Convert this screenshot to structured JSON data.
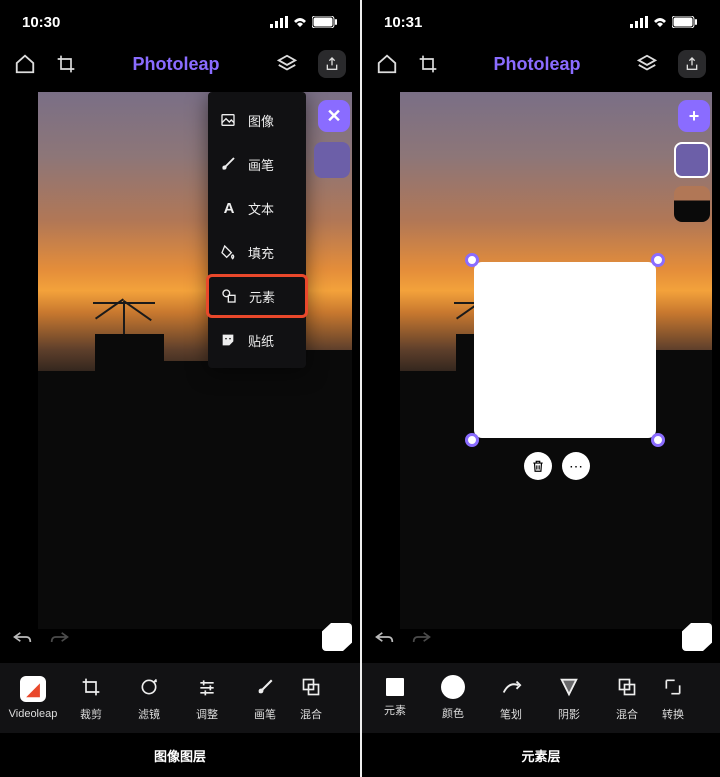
{
  "left": {
    "status": {
      "time": "10:30"
    },
    "brand": "Photoleap",
    "menu": {
      "items": [
        {
          "label": "图像"
        },
        {
          "label": "画笔"
        },
        {
          "label": "文本"
        },
        {
          "label": "填充"
        },
        {
          "label": "元素"
        },
        {
          "label": "贴纸"
        }
      ]
    },
    "close": "✕",
    "toolbar": [
      {
        "label": "Videoleap"
      },
      {
        "label": "裁剪"
      },
      {
        "label": "滤镜"
      },
      {
        "label": "调整"
      },
      {
        "label": "画笔"
      },
      {
        "label": "混合"
      }
    ],
    "layerLabel": "图像图层"
  },
  "right": {
    "status": {
      "time": "10:31"
    },
    "brand": "Photoleap",
    "plus": "+",
    "toolbar": [
      {
        "label": "元素"
      },
      {
        "label": "颜色"
      },
      {
        "label": "笔划"
      },
      {
        "label": "阴影"
      },
      {
        "label": "混合"
      },
      {
        "label": "转换"
      }
    ],
    "layerLabel": "元素层"
  }
}
